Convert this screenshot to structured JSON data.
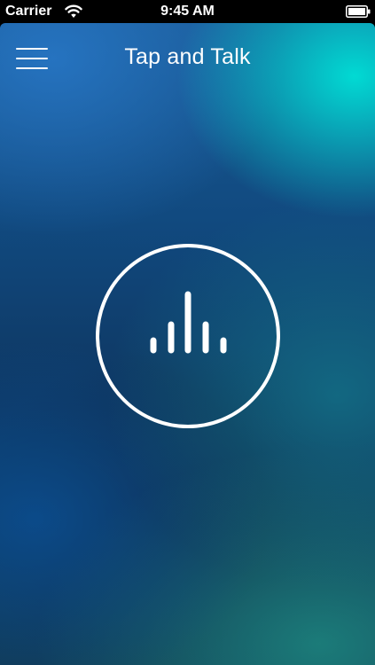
{
  "status_bar": {
    "carrier": "Carrier",
    "time": "9:45 AM",
    "wifi_icon": "wifi-icon",
    "battery_icon": "battery-icon"
  },
  "header": {
    "menu_icon": "hamburger-menu-icon",
    "title": "Tap and Talk"
  },
  "main": {
    "talk_button_icon": "audio-waveform-icon"
  },
  "colors": {
    "text": "#ffffff",
    "accent_teal": "#00e1d7",
    "base_blue": "#0f3b66"
  }
}
